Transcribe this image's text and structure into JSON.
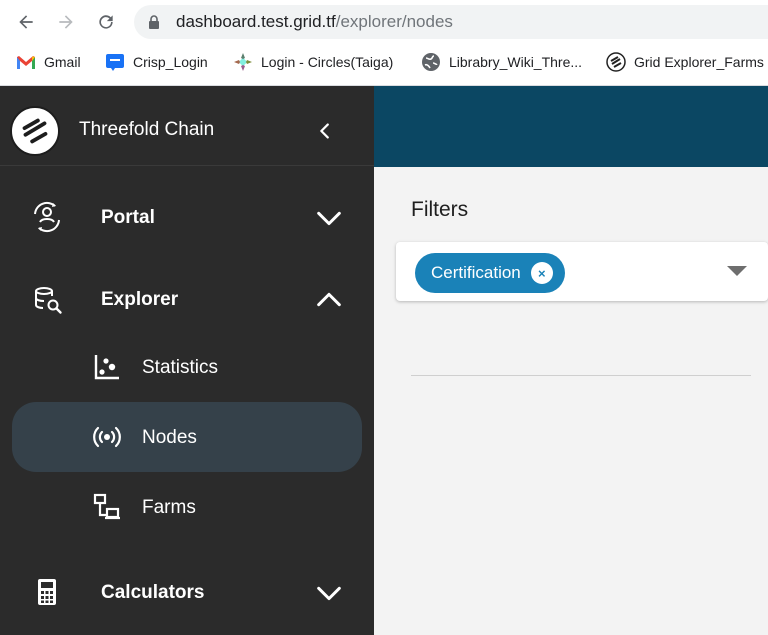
{
  "browser": {
    "url_host": "dashboard.test.grid.tf",
    "url_path": "/explorer/nodes",
    "bookmarks": [
      {
        "label": "Gmail",
        "icon": "gmail-icon"
      },
      {
        "label": "Crisp_Login",
        "icon": "crisp-icon"
      },
      {
        "label": "Login - Circles(Taiga)",
        "icon": "taiga-icon"
      },
      {
        "label": "Librabry_Wiki_Thre...",
        "icon": "globe-icon"
      },
      {
        "label": "Grid Explorer_Farms",
        "icon": "threefold-icon"
      }
    ]
  },
  "sidebar": {
    "brand": "Threefold Chain",
    "items": [
      {
        "label": "Portal",
        "icon": "portal-icon",
        "expanded": false
      },
      {
        "label": "Explorer",
        "icon": "explorer-icon",
        "expanded": true
      },
      {
        "label": "Calculators",
        "icon": "calculator-icon",
        "expanded": false
      }
    ],
    "explorer_children": [
      {
        "label": "Statistics",
        "icon": "statistics-icon",
        "active": false
      },
      {
        "label": "Nodes",
        "icon": "nodes-icon",
        "active": true
      },
      {
        "label": "Farms",
        "icon": "farms-icon",
        "active": false
      }
    ]
  },
  "main": {
    "filters_title": "Filters",
    "chip_label": "Certification",
    "chip_close": "×"
  },
  "colors": {
    "sidebar_bg": "#2b2b2b",
    "topbar_bg": "#0b4763",
    "chip_bg": "#1a82b8",
    "active_item_bg": "#35414a"
  }
}
